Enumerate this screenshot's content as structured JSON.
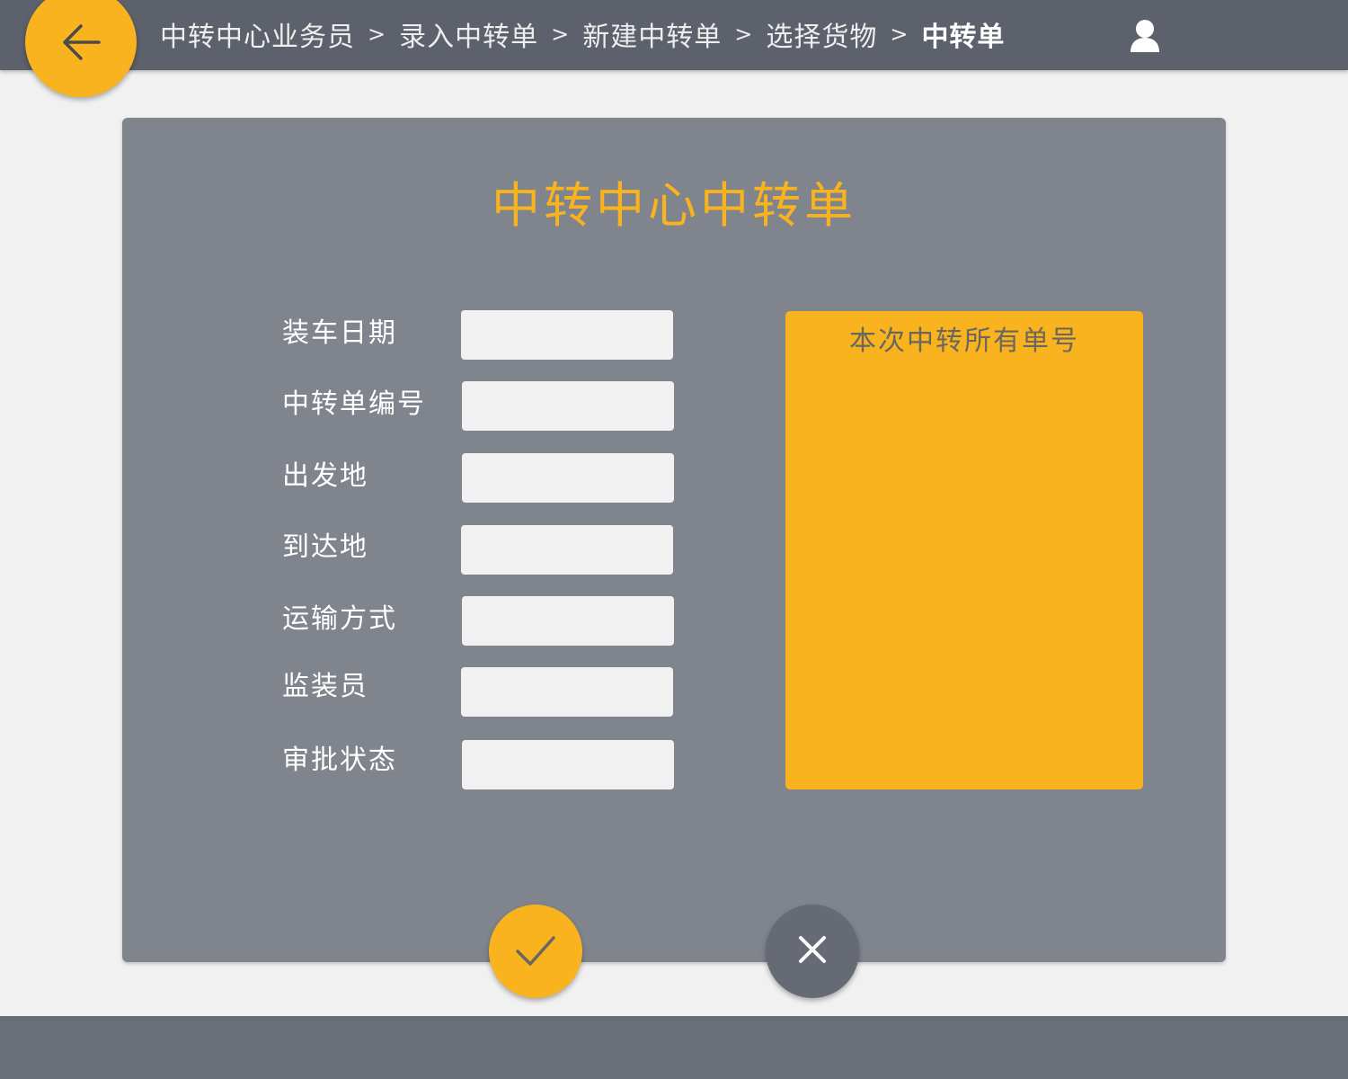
{
  "header": {
    "breadcrumb": [
      "中转中心业务员",
      "录入中转单",
      "新建中转单",
      "选择货物",
      "中转单"
    ],
    "separator": ">",
    "back_icon": "arrow-left-icon",
    "user_icon": "user-icon"
  },
  "form": {
    "title": "中转中心中转单",
    "fields": [
      {
        "label": "装车日期",
        "value": ""
      },
      {
        "label": "中转单编号",
        "value": ""
      },
      {
        "label": "出发地",
        "value": ""
      },
      {
        "label": "到达地",
        "value": ""
      },
      {
        "label": "运输方式",
        "value": ""
      },
      {
        "label": "监装员",
        "value": ""
      },
      {
        "label": "审批状态",
        "value": ""
      }
    ],
    "orders_box_title": "本次中转所有单号",
    "orders": []
  },
  "actions": {
    "confirm_icon": "check-icon",
    "cancel_icon": "close-icon"
  },
  "colors": {
    "accent": "#f8b31e",
    "header": "#5d616b",
    "panel": "#80848c",
    "footer": "#6a6e78"
  }
}
